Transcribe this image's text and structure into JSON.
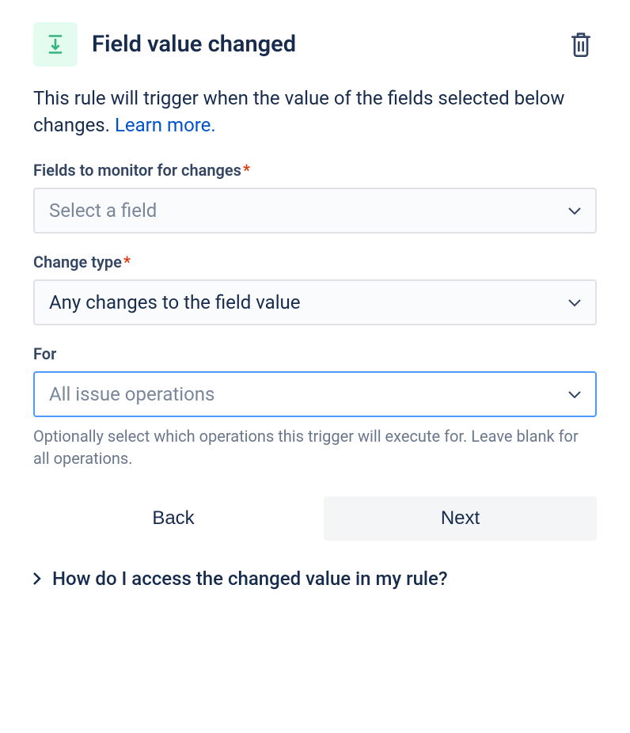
{
  "header": {
    "title": "Field value changed"
  },
  "description": {
    "text": "This rule will trigger when the value of the fields selected below changes. ",
    "link_text": "Learn more."
  },
  "fields_monitor": {
    "label": "Fields to monitor for changes",
    "placeholder": "Select a field",
    "value": ""
  },
  "change_type": {
    "label": "Change type",
    "value": "Any changes to the field value"
  },
  "for_field": {
    "label": "For",
    "placeholder": "All issue operations",
    "help": "Optionally select which operations this trigger will execute for. Leave blank for all operations."
  },
  "buttons": {
    "back": "Back",
    "next": "Next"
  },
  "expand": {
    "label": "How do I access the changed value in my rule?"
  }
}
